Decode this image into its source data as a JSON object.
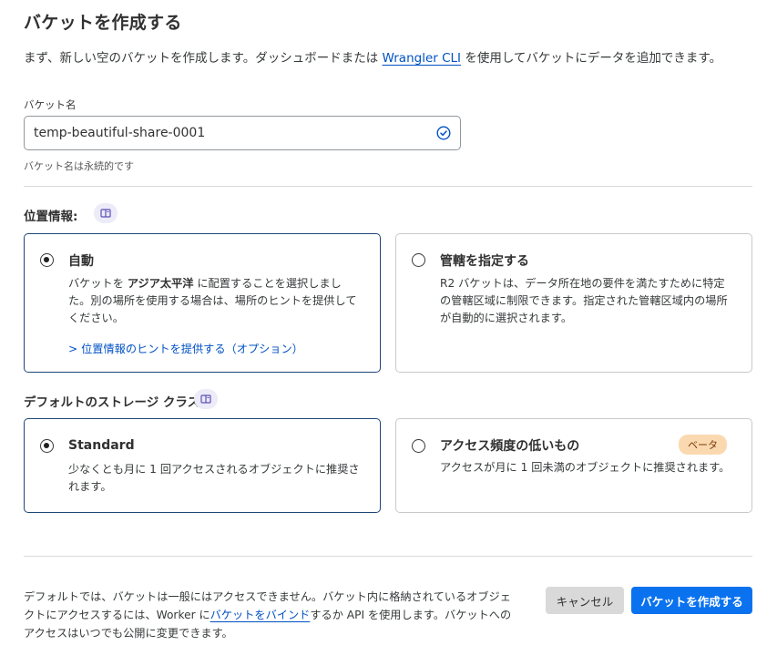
{
  "page": {
    "title": "バケットを作成する",
    "intro_before": "まず、新しい空のバケットを作成します。ダッシュボードまたは ",
    "intro_link": "Wrangler CLI",
    "intro_after": " を使用してバケットにデータを追加できます。"
  },
  "bucket_name": {
    "label": "バケット名",
    "value": "temp-beautiful-share-0001",
    "hint": "バケット名は永続的です",
    "valid_icon": "check-circle-icon"
  },
  "location": {
    "label": "位置情報:",
    "doc_icon": "book-icon",
    "options": [
      {
        "title": "自動",
        "selected": true,
        "body_prefix": "バケットを ",
        "body_bold": "アジア太平洋",
        "body_suffix": " に配置することを選択しました。別の場所を使用する場合は、場所のヒントを提供してください。",
        "link": "> 位置情報のヒントを提供する（オプション）"
      },
      {
        "title": "管轄を指定する",
        "selected": false,
        "body": "R2 バケットは、データ所在地の要件を満たすために特定の管轄区域に制限できます。指定された管轄区域内の場所が自動的に選択されます。"
      }
    ]
  },
  "storage_class": {
    "label": "デフォルトのストレージ クラス:",
    "doc_icon": "book-icon",
    "options": [
      {
        "title": "Standard",
        "selected": true,
        "body": "少なくとも月に 1 回アクセスされるオブジェクトに推奨されます。"
      },
      {
        "title": "アクセス頻度の低いもの",
        "selected": false,
        "badge": "ベータ",
        "body": "アクセスが月に 1 回未満のオブジェクトに推奨されます。"
      }
    ]
  },
  "footer": {
    "text_before": "デフォルトでは、バケットは一般にはアクセスできません。バケット内に格納されているオブジェクトにアクセスするには、Worker に",
    "text_link": "バケットをバインド",
    "text_after": "するか API を使用します。バケットへのアクセスはいつでも公開に変更できます。",
    "cancel_label": "キャンセル",
    "create_label": "バケットを作成する"
  },
  "colors": {
    "accent": "#0a72ef",
    "link": "#0051c3",
    "valid": "#0051c3",
    "selected_border": "#1d4677",
    "beta_bg": "#fbd9b0"
  }
}
